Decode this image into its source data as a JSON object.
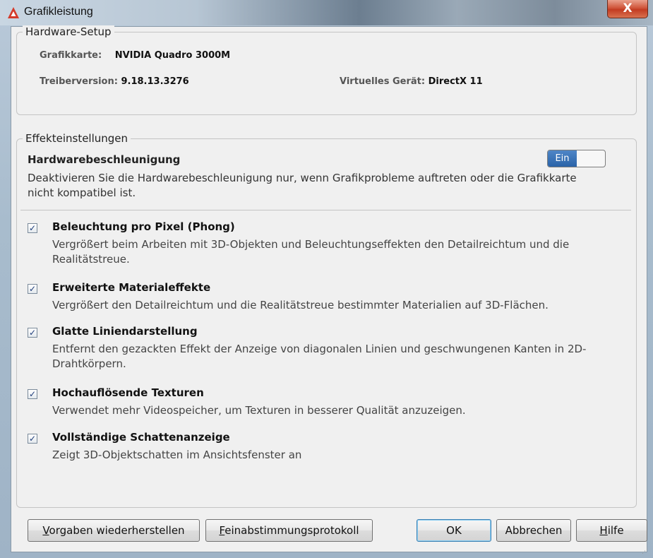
{
  "window": {
    "title": "Grafikleistung",
    "close_label": "X",
    "brand_color": "#d43a2a"
  },
  "hardware": {
    "legend": "Hardware-Setup",
    "graphics_card_key": "Grafikkarte:",
    "graphics_card_value": "NVIDIA Quadro 3000M",
    "driver_key": "Treiberversion:",
    "driver_value": "9.18.13.3276",
    "virtual_device_key": "Virtuelles Gerät:",
    "virtual_device_value": "DirectX 11"
  },
  "effects": {
    "legend": "Effekteinstellungen",
    "hw_accel_title": "Hardwarebeschleunigung",
    "hw_accel_desc": "Deaktivieren Sie die Hardwarebeschleunigung nur, wenn Grafikprobleme auftreten oder die Grafikkarte nicht kompatibel ist.",
    "toggle_label": "Ein",
    "toggle_state": "on",
    "options": [
      {
        "title": "Beleuchtung pro Pixel (Phong)",
        "desc": "Vergrößert beim Arbeiten mit 3D-Objekten und Beleuchtungseffekten den Detailreichtum und die Realitätstreue.",
        "checked": true
      },
      {
        "title": "Erweiterte Materialeffekte",
        "desc": "Vergrößert den Detailreichtum und die Realitätstreue bestimmter Materialien auf 3D-Flächen.",
        "checked": true
      },
      {
        "title": "Glatte Liniendarstellung",
        "desc": "Entfernt den gezackten Effekt der Anzeige von diagonalen Linien und geschwungenen Kanten in 2D-Drahtkörpern.",
        "checked": true
      },
      {
        "title": "Hochauflösende Texturen",
        "desc": "Verwendet mehr Videospeicher, um Texturen in besserer Qualität anzuzeigen.",
        "checked": true
      },
      {
        "title": "Vollständige Schattenanzeige",
        "desc": "Zeigt 3D-Objektschatten im Ansichtsfenster an",
        "checked": true
      }
    ]
  },
  "buttons": {
    "restore_prefix": "V",
    "restore_rest": "orgaben wiederherstellen",
    "log_prefix": "F",
    "log_rest": "einabstimmungsprotokoll",
    "ok": "OK",
    "cancel": "Abbrechen",
    "help_prefix": "H",
    "help_rest": "ilfe"
  }
}
